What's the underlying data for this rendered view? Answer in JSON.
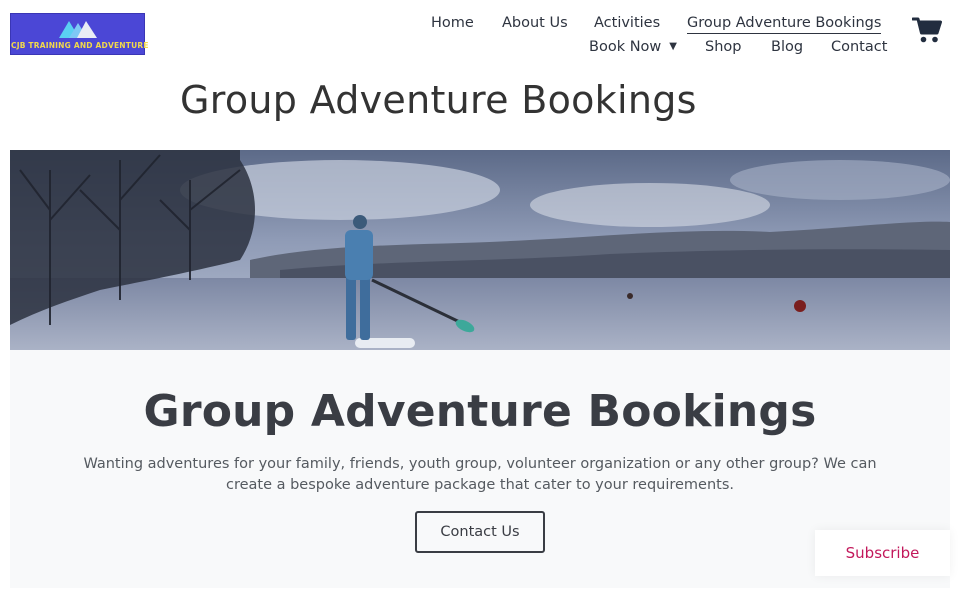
{
  "logo": {
    "text": "CJB TRAINING AND ADVENTURE"
  },
  "nav": {
    "row1": [
      "Home",
      "About Us",
      "Activities",
      "Group Adventure Bookings"
    ],
    "row2": [
      "Book Now",
      "Shop",
      "Blog",
      "Contact"
    ]
  },
  "page_title": "Group Adventure Bookings",
  "hero": {
    "image": "paddleboarder-on-lake"
  },
  "panel": {
    "heading": "Group Adventure Bookings",
    "text": "Wanting adventures for your family, friends, youth group, volunteer organization or any other group? We can create a bespoke adventure package that cater to your requirements.",
    "button": "Contact Us"
  },
  "subscribe": "Subscribe",
  "colors": {
    "logo_bg": "#4b47d6",
    "logo_text": "#f2d94a",
    "subscribe": "#c2185b",
    "nav_text": "#2e3440"
  },
  "icons": {
    "cart": "shopping-cart-icon",
    "book_now_caret": "caret-down-icon"
  }
}
